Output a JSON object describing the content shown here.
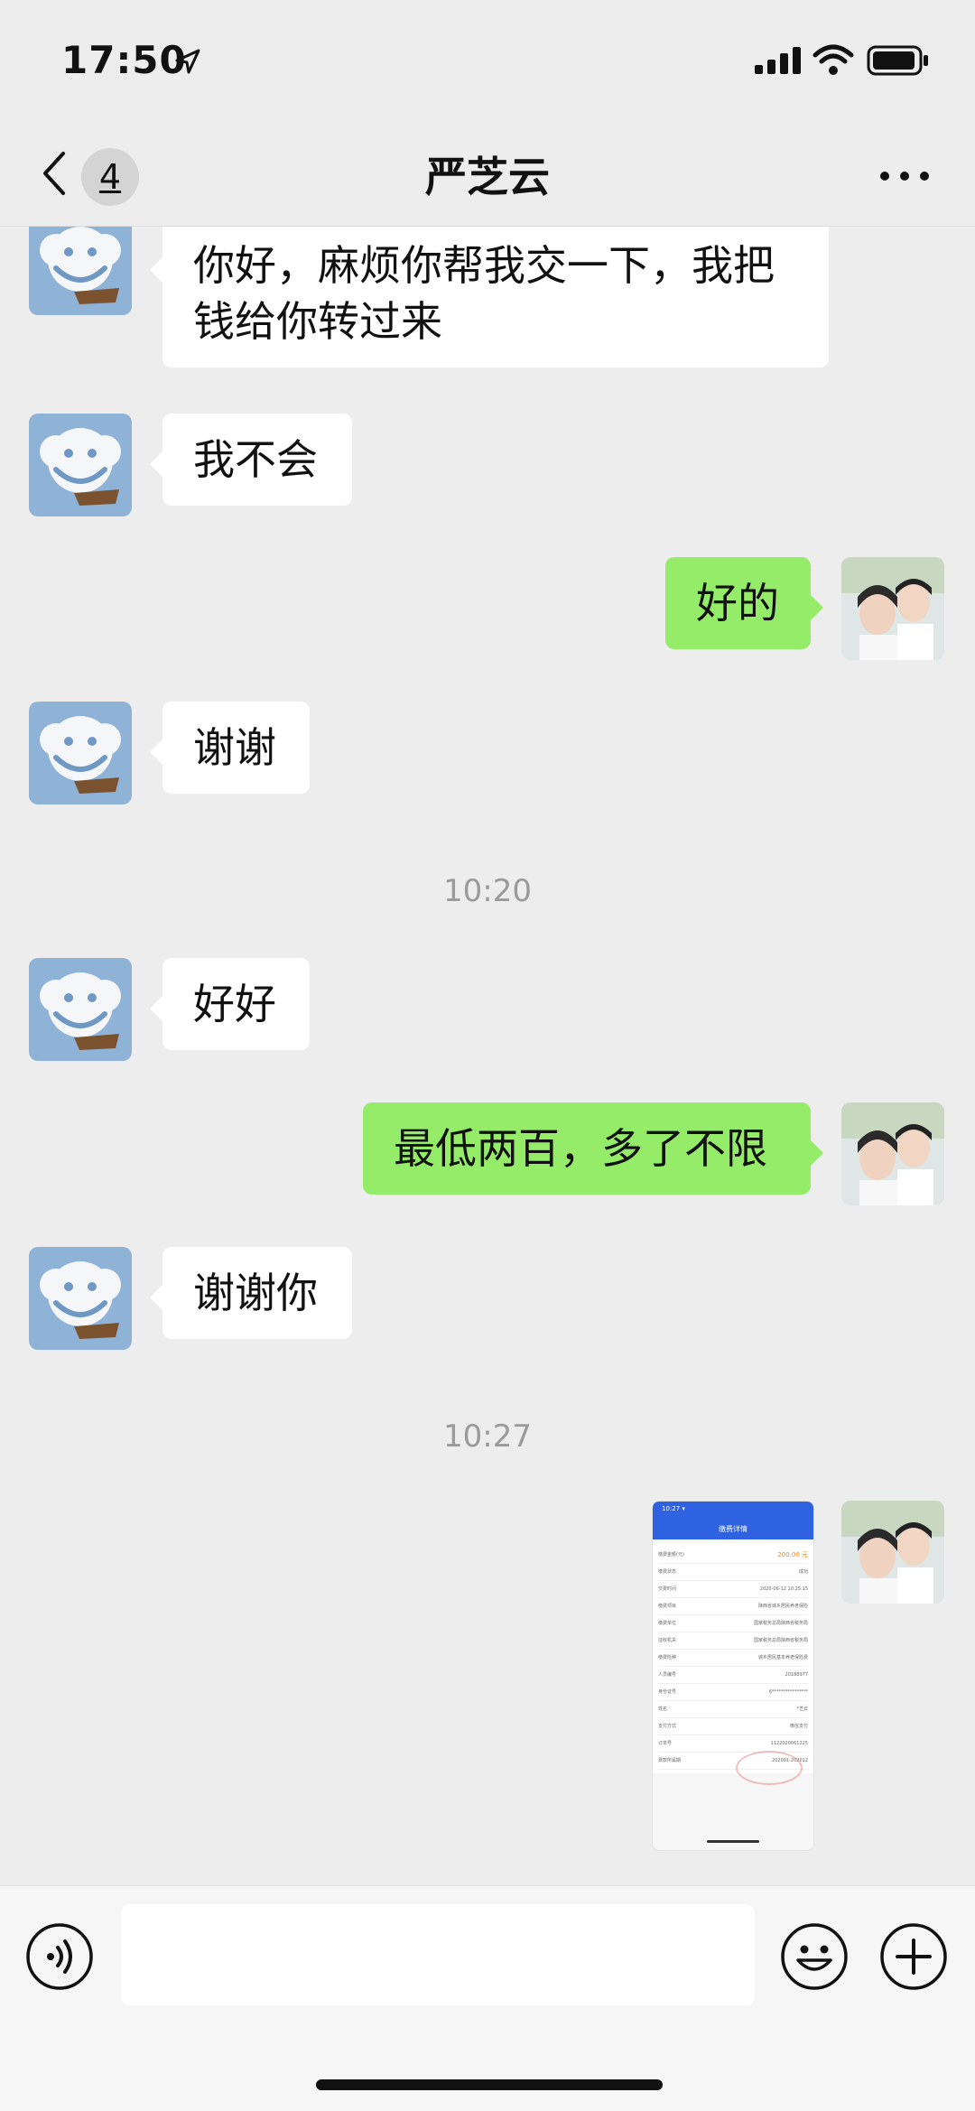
{
  "status": {
    "time": "17:50"
  },
  "header": {
    "back_count": "4",
    "title": "严芝云"
  },
  "messages": [
    {
      "text": "你好，麻烦你帮我交一下，我把钱给你转过来"
    },
    {
      "text": "我不会"
    },
    {
      "text": "好的"
    },
    {
      "text": "谢谢"
    },
    {
      "text": "10:20"
    },
    {
      "text": "好好"
    },
    {
      "text": "最低两百，多了不限"
    },
    {
      "text": "谢谢你"
    },
    {
      "text": "10:27"
    }
  ],
  "shared_screenshot": {
    "status_time": "10:27 ▾",
    "title": "缴费详情",
    "amount_label": "缴费金额(元)",
    "amount": "200.00 元",
    "rows": [
      {
        "label": "缴费状态",
        "value": "成功"
      },
      {
        "label": "交费时间",
        "value": "2020-06-12 10:25:15"
      },
      {
        "label": "缴费项目",
        "value": "陕西省城乡居民养老保险"
      },
      {
        "label": "缴费单位",
        "value": "国家税务总局陕西省税务局"
      },
      {
        "label": "征收机关",
        "value": "国家税务总局陕西省税务局"
      },
      {
        "label": "缴费险种",
        "value": "城乡居民基本养老保险费"
      },
      {
        "label": "人员编号",
        "value": "20188977"
      },
      {
        "label": "身份证号",
        "value": "6****************"
      },
      {
        "label": "姓名",
        "value": "*芝云"
      },
      {
        "label": "支付方式",
        "value": "微信支付"
      },
      {
        "label": "订单号",
        "value": "1122020061225"
      },
      {
        "label": "费款所属期",
        "value": "202001-202012"
      }
    ]
  },
  "input": {
    "placeholder": ""
  }
}
